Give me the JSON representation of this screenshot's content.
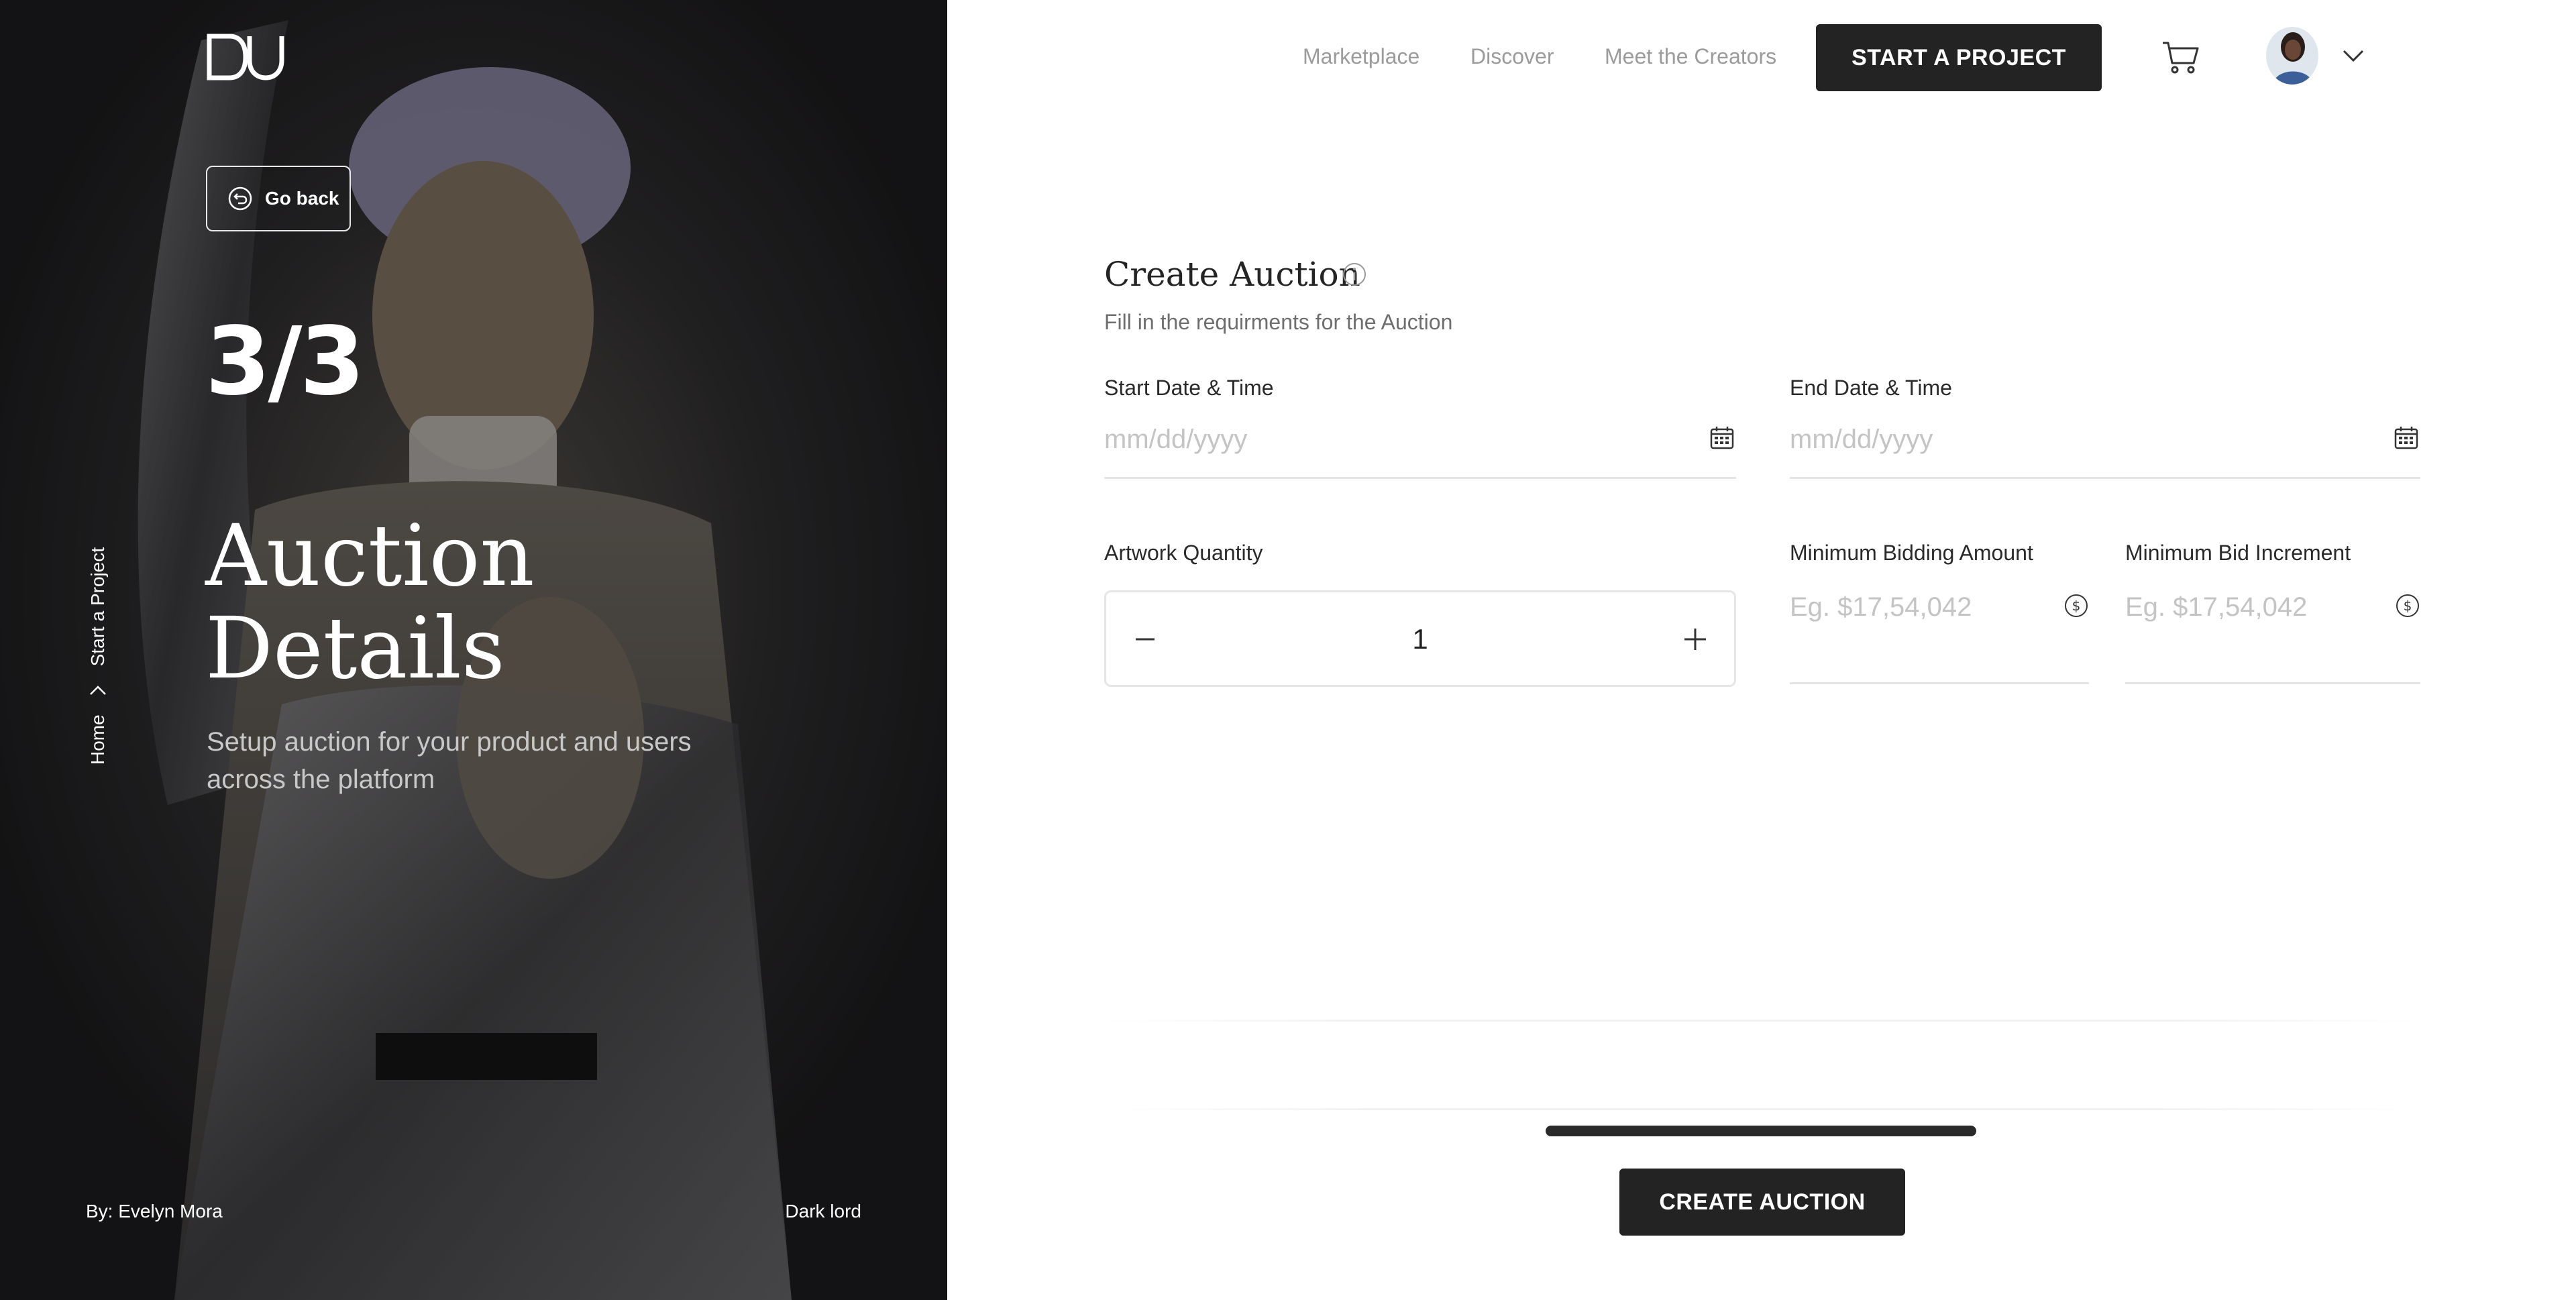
{
  "hero": {
    "logo_alt": "DV",
    "go_back_label": "Go back",
    "step": "3/3",
    "title_line1": "Auction",
    "title_line2": "Details",
    "subtitle": "Setup auction for your product and users across the platform",
    "breadcrumb": {
      "home": "Home",
      "current": "Start a Project"
    },
    "credit_left": "By: Evelyn Mora",
    "credit_right": "Dark lord"
  },
  "nav": {
    "links": [
      "Marketplace",
      "Discover",
      "Meet the Creators"
    ],
    "cta_label": "START A PROJECT",
    "cart_icon": "cart-icon",
    "profile_menu_icon": "chevron-down-icon"
  },
  "form": {
    "title": "Create Auction",
    "subtitle": "Fill in the requirments for the Auction",
    "start_date": {
      "label": "Start Date & Time",
      "placeholder": "mm/dd/yyyy",
      "icon": "calendar-icon"
    },
    "end_date": {
      "label": "End Date & Time",
      "placeholder": "mm/dd/yyyy",
      "icon": "calendar-icon"
    },
    "quantity": {
      "label": "Artwork Quantity",
      "value": "1"
    },
    "min_bid": {
      "label": "Minimum Bidding Amount",
      "placeholder": "Eg. $17,54,042",
      "icon": "dollar-icon"
    },
    "bid_increment": {
      "label": "Minimum Bid Increment",
      "placeholder": "Eg. $17,54,042",
      "icon": "dollar-icon"
    },
    "progress": 1.0,
    "submit_label": "CREATE AUCTION"
  },
  "colors": {
    "panel_bg": "#1b1a1c",
    "button_dark": "#232323",
    "muted_text": "#9b9b9b",
    "placeholder": "#c4c4c4"
  }
}
